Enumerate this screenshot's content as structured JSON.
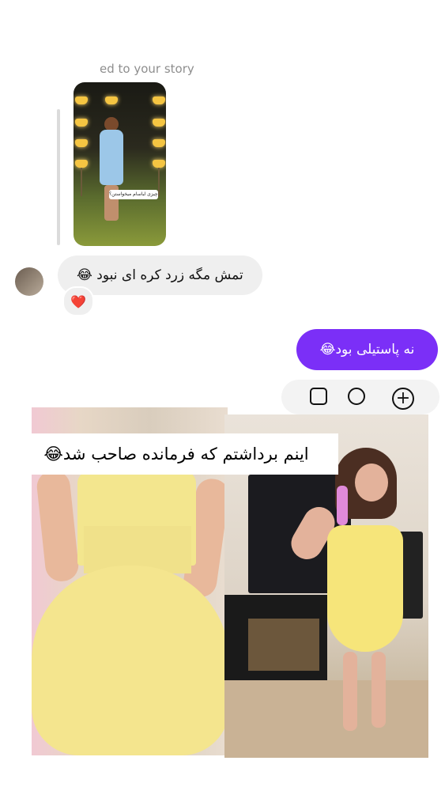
{
  "story": {
    "note": "ed to your story",
    "sticker_text": "کی چه چیزی لباسام میخواستن؟!"
  },
  "incoming": {
    "message": "تمش مگه زرد کره ای نبود 😂",
    "reaction": "❤️"
  },
  "outgoing": {
    "message": "نه پاستیلی بود😂"
  },
  "collage": {
    "caption": "اینم برداشتم که فرمانده صاحب شد😂"
  },
  "colors": {
    "outgoing_bubble": "#7b2ff7",
    "incoming_bubble": "#efefef"
  }
}
